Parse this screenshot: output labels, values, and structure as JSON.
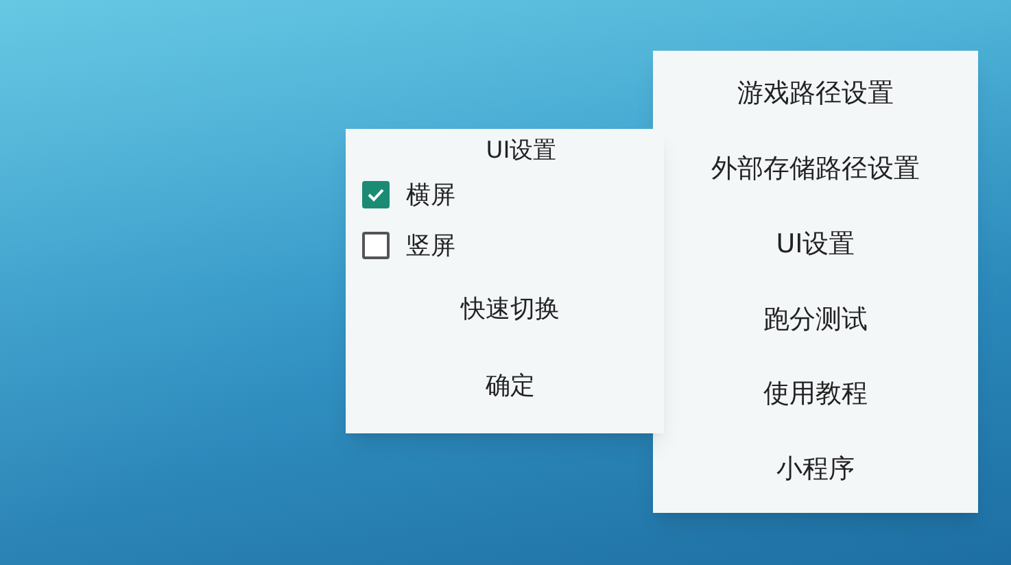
{
  "menu": {
    "items": [
      {
        "label": "游戏路径设置"
      },
      {
        "label": "外部存储路径设置"
      },
      {
        "label": "UI设置"
      },
      {
        "label": "跑分测试"
      },
      {
        "label": "使用教程"
      },
      {
        "label": "小程序"
      }
    ]
  },
  "dialog": {
    "title": "UI设置",
    "options": [
      {
        "label": "横屏",
        "checked": true
      },
      {
        "label": "竖屏",
        "checked": false
      }
    ],
    "buttons": [
      {
        "label": "快速切换"
      },
      {
        "label": "确定"
      }
    ]
  }
}
